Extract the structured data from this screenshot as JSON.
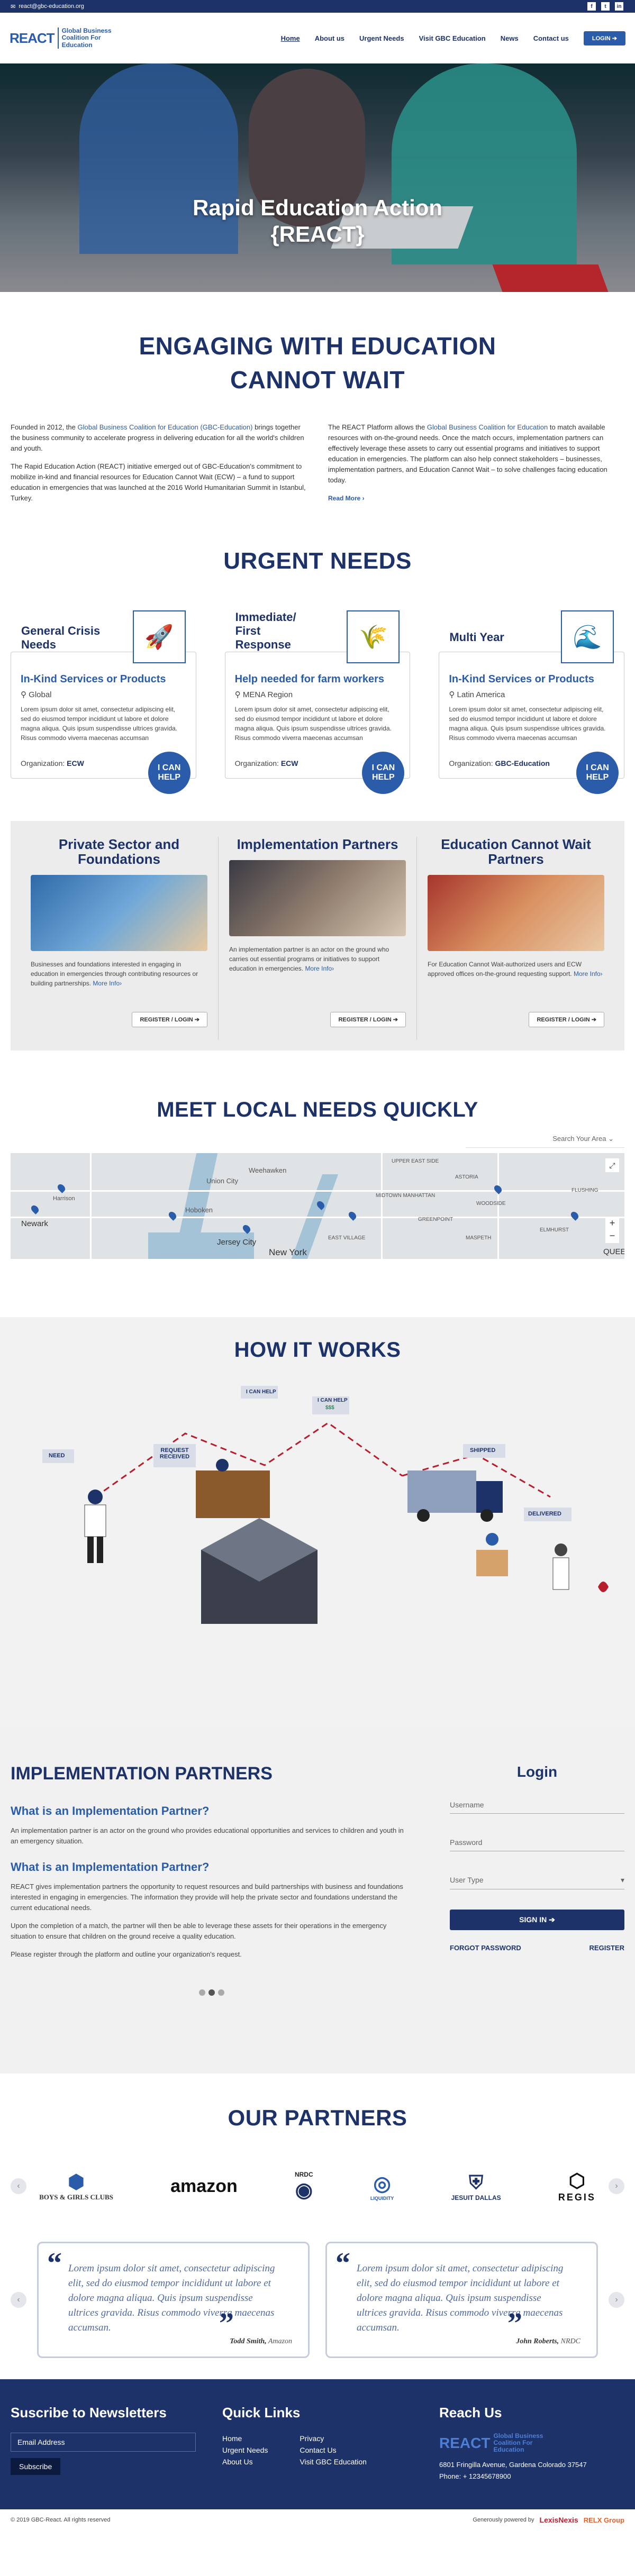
{
  "topbar": {
    "email": "react@gbc-education.org",
    "socials": [
      "f",
      "t",
      "in"
    ]
  },
  "header": {
    "logo_big": "REACT",
    "logo_small": "Global Business Coalition For Education",
    "nav": [
      "Home",
      "About us",
      "Urgent Needs",
      "Visit GBC Education",
      "News",
      "Contact us"
    ],
    "login": "LOGIN"
  },
  "hero": {
    "line1": "Rapid Education Action",
    "line2": "{REACT}"
  },
  "intro": {
    "title_line1": "ENGAGING WITH EDUCATION",
    "title_line2": "CANNOT WAIT",
    "p1_before": "Founded in 2012, the ",
    "p1_link": "Global Business Coalition for Education (GBC-Education)",
    "p1_after": " brings together the business community to accelerate progress in delivering education for all the world's children and youth.",
    "p2": "The Rapid Education Action (REACT) initiative emerged out of GBC-Education's commitment to mobilize in-kind and financial resources for Education Cannot Wait (ECW) – a fund to support education in emergencies that was launched at the 2016 World Humanitarian Summit in Istanbul, Turkey.",
    "p3_before": "The REACT Platform allows the ",
    "p3_link": "Global Business Coalition for Education",
    "p3_after": " to match available resources with on-the-ground needs. Once the match occurs, implementation partners can effectively leverage these assets to carry out essential programs and initiatives to support education in emergencies. The platform can also help connect stakeholders – businesses, implementation partners, and Education Cannot Wait – to solve challenges facing education today.",
    "read_more": "Read More ›"
  },
  "urgent": {
    "title": "URGENT NEEDS",
    "cards": [
      {
        "title": "General Crisis Needs",
        "icon": "rocket-icon",
        "sub": "In-Kind Services or Products",
        "loc": "Global",
        "text": "Lorem ipsum dolor sit amet, consectetur adipiscing elit, sed do eiusmod tempor incididunt ut labore et dolore magna aliqua. Quis ipsum suspendisse ultrices gravida. Risus commodo viverra maecenas accumsan",
        "org_label": "Organization:",
        "org": "ECW",
        "help": "I CAN HELP"
      },
      {
        "title": "Immediate/ First Response",
        "icon": "wheat-icon",
        "sub": "Help needed for farm workers",
        "loc": "MENA Region",
        "text": "Lorem ipsum dolor sit amet, consectetur adipiscing elit, sed do eiusmod tempor incididunt ut labore et dolore magna aliqua. Quis ipsum suspendisse ultrices gravida. Risus commodo viverra maecenas accumsan",
        "org_label": "Organization:",
        "org": "ECW",
        "help": "I CAN HELP"
      },
      {
        "title": "Multi Year",
        "icon": "wave-icon",
        "sub": "In-Kind Services or Products",
        "loc": "Latin America",
        "text": "Lorem ipsum dolor sit amet, consectetur adipiscing elit, sed do eiusmod tempor incididunt ut labore et dolore magna aliqua. Quis ipsum suspendisse ultrices gravida. Risus commodo viverra maecenas accumsan",
        "org_label": "Organization:",
        "org": "GBC-Education",
        "help": "I CAN HELP"
      }
    ]
  },
  "partner_types": [
    {
      "title": "Private Sector and Foundations",
      "text": "Businesses and foundations interested in engaging in education in emergencies through contributing resources or building partnerships.",
      "more": "More Info›",
      "btn": "REGISTER / LOGIN"
    },
    {
      "title": "Implementation Partners",
      "text": "An implementation partner is an actor on the ground who carries out essential programs or initiatives to support education in emergencies.",
      "more": "More Info›",
      "btn": "REGISTER / LOGIN"
    },
    {
      "title": "Education Cannot Wait Partners",
      "text": "For Education Cannot Wait-authorized users and ECW approved offices on-the-ground requesting support.",
      "more": "More Info›",
      "btn": "REGISTER / LOGIN"
    }
  ],
  "map": {
    "title": "MEET LOCAL NEEDS QUICKLY",
    "search_placeholder": "Search Your Area",
    "labels": [
      "Newark",
      "Jersey City",
      "New York",
      "Hoboken",
      "Harrison",
      "ASTORIA",
      "MIDTOWN MANHATTAN",
      "FLUSHING",
      "WOODSIDE",
      "MASPETH",
      "GREENPOINT",
      "EAST VILLAGE",
      "ELMHURST",
      "UPPER EAST SIDE",
      "Weehawken",
      "Union City",
      "QUEE"
    ]
  },
  "how": {
    "title": "HOW IT WORKS",
    "tags": [
      "NEED",
      "REQUEST RECEIVED",
      "I CAN HELP",
      "I CAN HELP",
      "SHIPPED",
      "DELIVERED"
    ],
    "money": "$$$"
  },
  "ip": {
    "title": "IMPLEMENTATION PARTNERS",
    "q1": "What is an Implementation Partner?",
    "a1": "An implementation partner is an actor on the ground who provides educational opportunities and services to children and youth in an emergency situation.",
    "q2": "What is an Implementation Partner?",
    "a2": "REACT gives implementation partners the opportunity to request resources and build partnerships with business and foundations interested in engaging in emergencies. The information they provide will help the private sector and foundations understand the current educational needs.",
    "a3": "Upon the completion of a match, the partner will then be able to leverage these assets for their operations in the emergency situation to ensure that children on the ground receive a quality education.",
    "a4": "Please register through the platform and outline your organization's request."
  },
  "login": {
    "title": "Login",
    "username": "Username",
    "password": "Password",
    "user_type": "User Type",
    "signin": "SIGN IN",
    "forgot": "FORGOT PASSWORD",
    "register": "REGISTER"
  },
  "our_partners": {
    "title": "OUR PARTNERS",
    "logos": [
      "BOYS & GIRLS CLUBS",
      "amazon",
      "NRDC",
      "LIQUIDITY",
      "JESUIT DALLAS",
      "REGIS"
    ],
    "quotes": [
      {
        "text": "Lorem ipsum dolor sit amet, consectetur adipiscing elit, sed do eiusmod tempor incididunt ut labore et dolore magna aliqua. Quis ipsum suspendisse ultrices gravida. Risus commodo viverra maecenas accumsan.",
        "name": "Todd Smith,",
        "org": "Amazon"
      },
      {
        "text": "Lorem ipsum dolor sit amet, consectetur adipiscing elit, sed do eiusmod tempor incididunt ut labore et dolore magna aliqua. Quis ipsum suspendisse ultrices gravida. Risus commodo viverra maecenas accumsan.",
        "name": "John Roberts,",
        "org": "NRDC"
      }
    ]
  },
  "footer": {
    "newsletter_title": "Suscribe to Newsletters",
    "email_placeholder": "Email Address",
    "subscribe": "Subscribe",
    "quick_title": "Quick Links",
    "links_a": [
      "Home",
      "Urgent Needs",
      "About Us"
    ],
    "links_b": [
      "Privacy",
      "Contact Us",
      "Visit GBC Education"
    ],
    "reach_title": "Reach Us",
    "address": "6801 Fringilla Avenue, Gardena Colorado 37547",
    "phone": "Phone: + 12345678900",
    "copyright": "© 2019 GBC-React. All rights reserved",
    "powered": "Generously powered by",
    "lexis": "LexisNexis",
    "relx": "RELX Group"
  }
}
